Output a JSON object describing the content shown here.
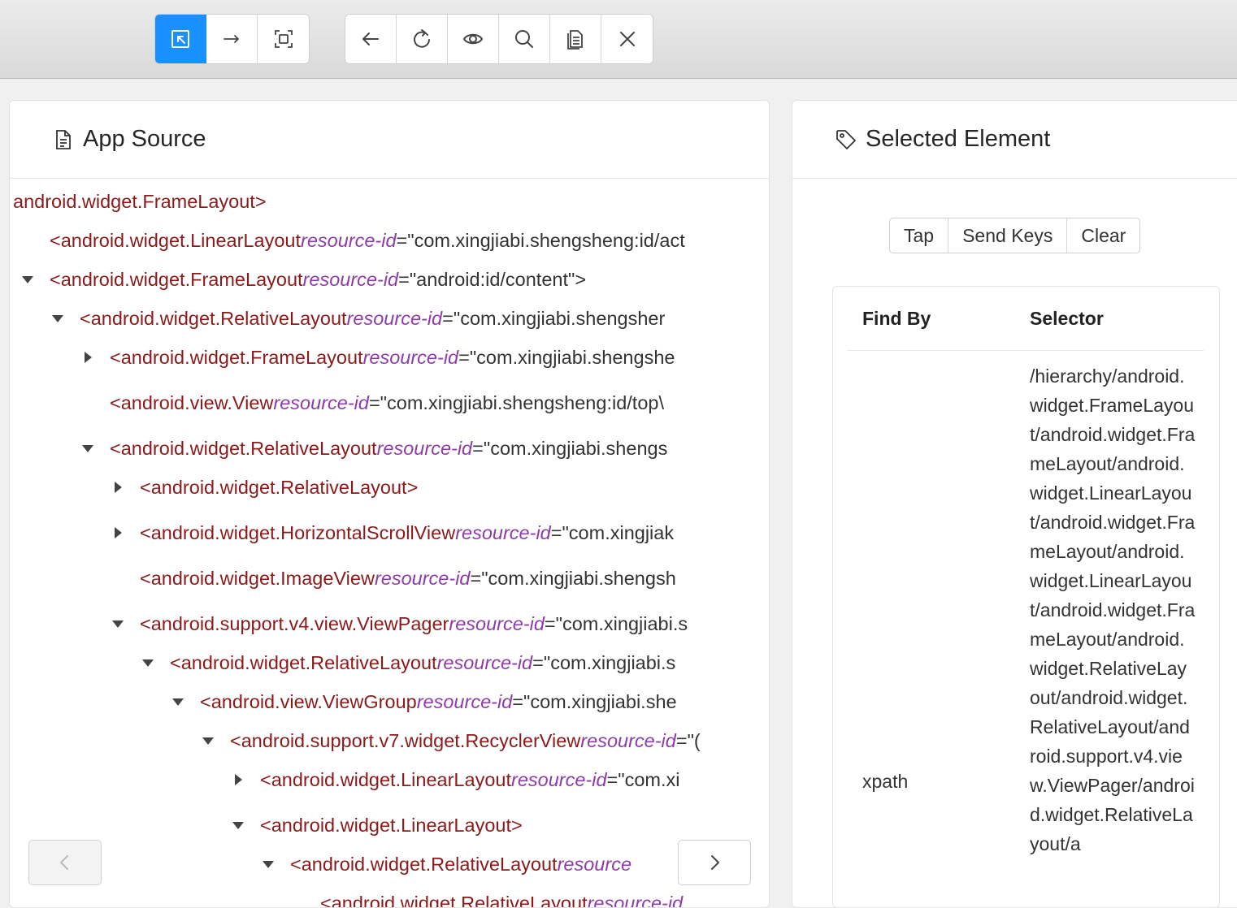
{
  "toolbar": {
    "group1": [
      {
        "icon": "select-element-icon",
        "active": true
      },
      {
        "icon": "swipe-arrow-icon",
        "active": false
      },
      {
        "icon": "tap-coordinates-icon",
        "active": false
      }
    ],
    "group2": [
      {
        "icon": "back-arrow-icon"
      },
      {
        "icon": "refresh-icon"
      },
      {
        "icon": "eye-icon"
      },
      {
        "icon": "search-icon"
      },
      {
        "icon": "copy-xml-icon"
      },
      {
        "icon": "close-icon"
      }
    ],
    "accent_color": "#1890ff"
  },
  "app_source": {
    "title": "App Source",
    "tree": [
      {
        "caret": "none",
        "tag": "android.widget.FrameLayout>",
        "attr": "",
        "val": ""
      },
      {
        "caret": "none",
        "tag": "<android.widget.LinearLayout ",
        "attr": "resource-id",
        "val": "=\"com.xingjiabi.shengsheng:id/act"
      },
      {
        "caret": "down",
        "tag": "<android.widget.FrameLayout ",
        "attr": "resource-id",
        "val": "=\"android:id/content\">"
      },
      {
        "caret": "down",
        "tag": "<android.widget.RelativeLayout ",
        "attr": "resource-id",
        "val": "=\"com.xingjiabi.shengsher"
      },
      {
        "caret": "right",
        "tag": "<android.widget.FrameLayout ",
        "attr": "resource-id",
        "val": "=\"com.xingjiabi.shengshe"
      },
      {
        "caret": "none",
        "tag": "<android.view.View ",
        "attr": "resource-id",
        "val": "=\"com.xingjiabi.shengsheng:id/top\\"
      },
      {
        "caret": "down",
        "tag": "<android.widget.RelativeLayout ",
        "attr": "resource-id",
        "val": "=\"com.xingjiabi.shengs"
      },
      {
        "caret": "right",
        "tag": "<android.widget.RelativeLayout>",
        "attr": "",
        "val": ""
      },
      {
        "caret": "right",
        "tag": "<android.widget.HorizontalScrollView ",
        "attr": "resource-id",
        "val": "=\"com.xingjiak"
      },
      {
        "caret": "none",
        "tag": "<android.widget.ImageView ",
        "attr": "resource-id",
        "val": "=\"com.xingjiabi.shengsh"
      },
      {
        "caret": "down",
        "tag": "<android.support.v4.view.ViewPager ",
        "attr": "resource-id",
        "val": "=\"com.xingjiabi.s"
      },
      {
        "caret": "down",
        "tag": "<android.widget.RelativeLayout ",
        "attr": "resource-id",
        "val": "=\"com.xingjiabi.s"
      },
      {
        "caret": "down",
        "tag": "<android.view.ViewGroup ",
        "attr": "resource-id",
        "val": "=\"com.xingjiabi.she"
      },
      {
        "caret": "down",
        "tag": "<android.support.v7.widget.RecyclerView ",
        "attr": "resource-id",
        "val": "=\"("
      },
      {
        "caret": "right",
        "tag": "<android.widget.LinearLayout ",
        "attr": "resource-id",
        "val": "=\"com.xi"
      },
      {
        "caret": "down",
        "tag": "<android.widget.LinearLayout>",
        "attr": "",
        "val": ""
      },
      {
        "caret": "down",
        "tag": "<android.widget.RelativeLayout ",
        "attr": "resource",
        "val": ""
      },
      {
        "caret": "none",
        "tag": "<android.widget.RelativeLayout ",
        "attr": "resource-id",
        "val": ""
      }
    ]
  },
  "selected_element": {
    "title": "Selected Element",
    "actions": {
      "tap": "Tap",
      "send_keys": "Send Keys",
      "clear": "Clear"
    },
    "table": {
      "col_findby": "Find By",
      "col_selector": "Selector",
      "rows": [
        {
          "find_by": "xpath",
          "selector": "/hierarchy/android.widget.FrameLayout/android.widget.FrameLayout/android.widget.LinearLayout/android.widget.FrameLayout/android.widget.LinearLayout/android.widget.FrameLayout/android.widget.RelativeLayout/android.widget.RelativeLayout/android.support.v4.view.ViewPager/android.widget.RelativeLayout/a"
        }
      ]
    }
  }
}
